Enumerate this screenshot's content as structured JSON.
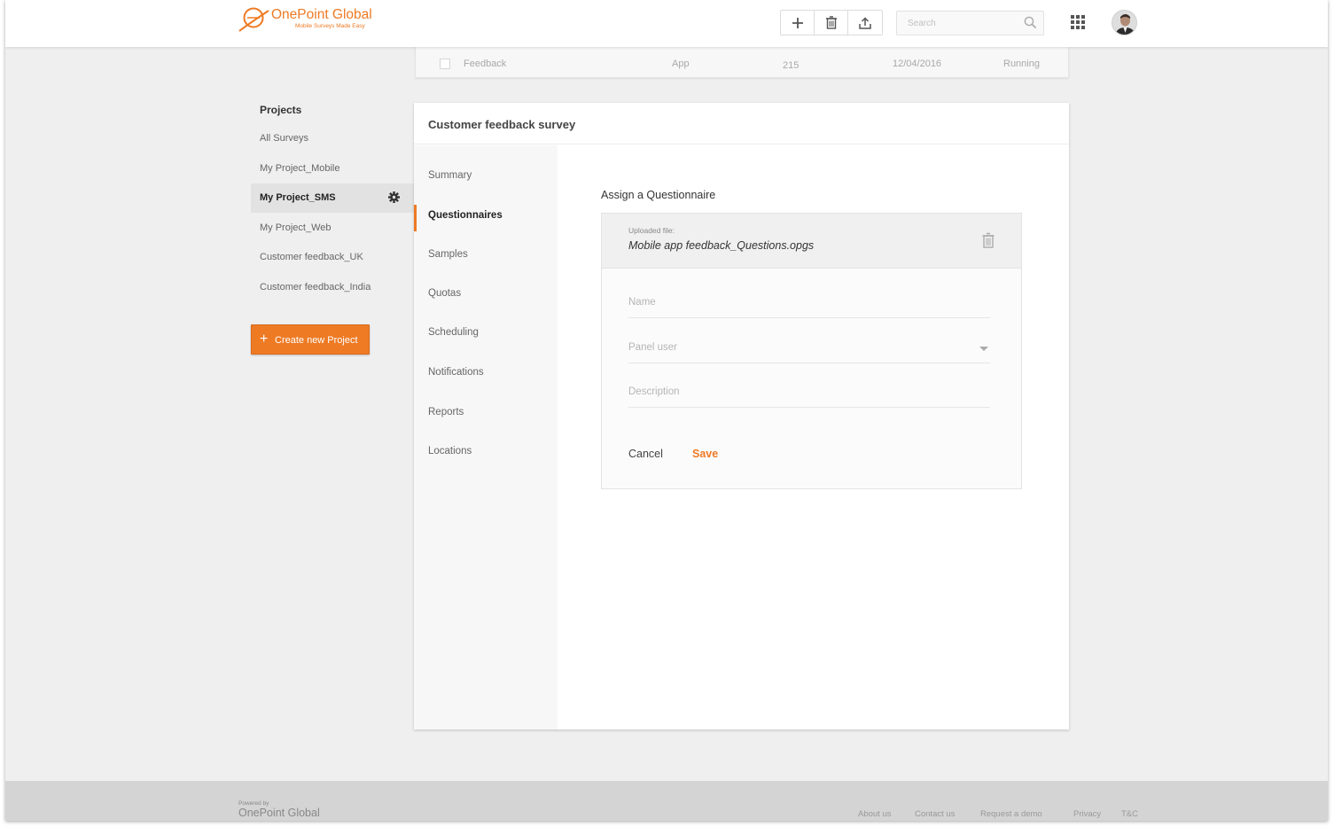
{
  "brand": {
    "name": "OnePoint Global",
    "tagline": "Mobile Surveys Made Easy",
    "accent": "#ee7a24"
  },
  "toolbar": {
    "add_icon": "plus-icon",
    "delete_icon": "trash-icon",
    "upload_icon": "upload-icon"
  },
  "search": {
    "placeholder": "Search"
  },
  "background_row": {
    "name": "Feedback",
    "type": "App",
    "count": "215",
    "date": "12/04/2016",
    "status": "Running"
  },
  "sidebar": {
    "title": "Projects",
    "items": [
      {
        "label": "All Surveys"
      },
      {
        "label": "My Project_Mobile"
      },
      {
        "label": "My Project_SMS"
      },
      {
        "label": "My Project_Web"
      },
      {
        "label": "Customer feedback_UK"
      },
      {
        "label": "Customer feedback_India"
      }
    ],
    "create_button": "Create new Project"
  },
  "panel": {
    "title": "Customer feedback survey",
    "tabs": [
      {
        "label": "Summary"
      },
      {
        "label": "Questionnaires"
      },
      {
        "label": "Samples"
      },
      {
        "label": "Quotas"
      },
      {
        "label": "Scheduling"
      },
      {
        "label": "Notifications"
      },
      {
        "label": "Reports"
      },
      {
        "label": "Locations"
      }
    ],
    "section_title": "Assign a Questionnaire",
    "uploaded_label": "Uploaded file:",
    "uploaded_file": "Mobile app feedback_Questions.opgs",
    "fields": {
      "name_placeholder": "Name",
      "panel_user_placeholder": "Panel user",
      "description_placeholder": "Description"
    },
    "cancel": "Cancel",
    "save": "Save"
  },
  "footer": {
    "powered_by": "Powered by",
    "logo": "OnePoint Global",
    "links": [
      "About us",
      "Contact us",
      "Request a demo",
      "Privacy",
      "T&C"
    ]
  }
}
